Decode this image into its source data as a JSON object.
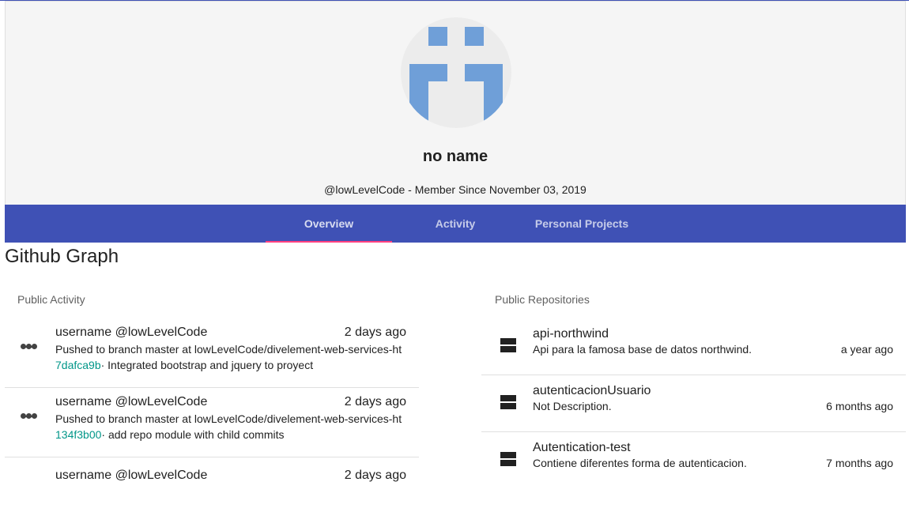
{
  "profile": {
    "name": "no name",
    "meta": "@lowLevelCode - Member Since November 03, 2019"
  },
  "tabs": [
    {
      "label": "Overview",
      "active": true
    },
    {
      "label": "Activity",
      "active": false
    },
    {
      "label": "Personal Projects",
      "active": false
    }
  ],
  "section_title": "Github Graph",
  "activity": {
    "title": "Public Activity",
    "items": [
      {
        "user": "username @lowLevelCode",
        "when": "2 days ago",
        "message": "Pushed to branch master at lowLevelCode/divelement-web-services-ht",
        "sha": "7dafca9b",
        "commit_msg": "· Integrated bootstrap and jquery to proyect"
      },
      {
        "user": "username @lowLevelCode",
        "when": "2 days ago",
        "message": "Pushed to branch master at lowLevelCode/divelement-web-services-ht",
        "sha": "134f3b00",
        "commit_msg": "· add repo module with child commits"
      },
      {
        "user": "username @lowLevelCode",
        "when": "2 days ago",
        "message": "",
        "sha": "",
        "commit_msg": ""
      }
    ]
  },
  "repositories": {
    "title": "Public Repositories",
    "items": [
      {
        "name": "api-northwind",
        "description": "Api para la famosa base de datos northwind.",
        "time": "a year ago"
      },
      {
        "name": "autenticacionUsuario",
        "description": "Not Description.",
        "time": "6 months ago"
      },
      {
        "name": "Autentication-test",
        "description": "Contiene diferentes forma de autenticacion.",
        "time": "7 months ago"
      }
    ]
  },
  "colors": {
    "primary": "#3f51b5",
    "accent": "#ff4081",
    "sha": "#009688",
    "avatar": "#6f9fd8"
  }
}
